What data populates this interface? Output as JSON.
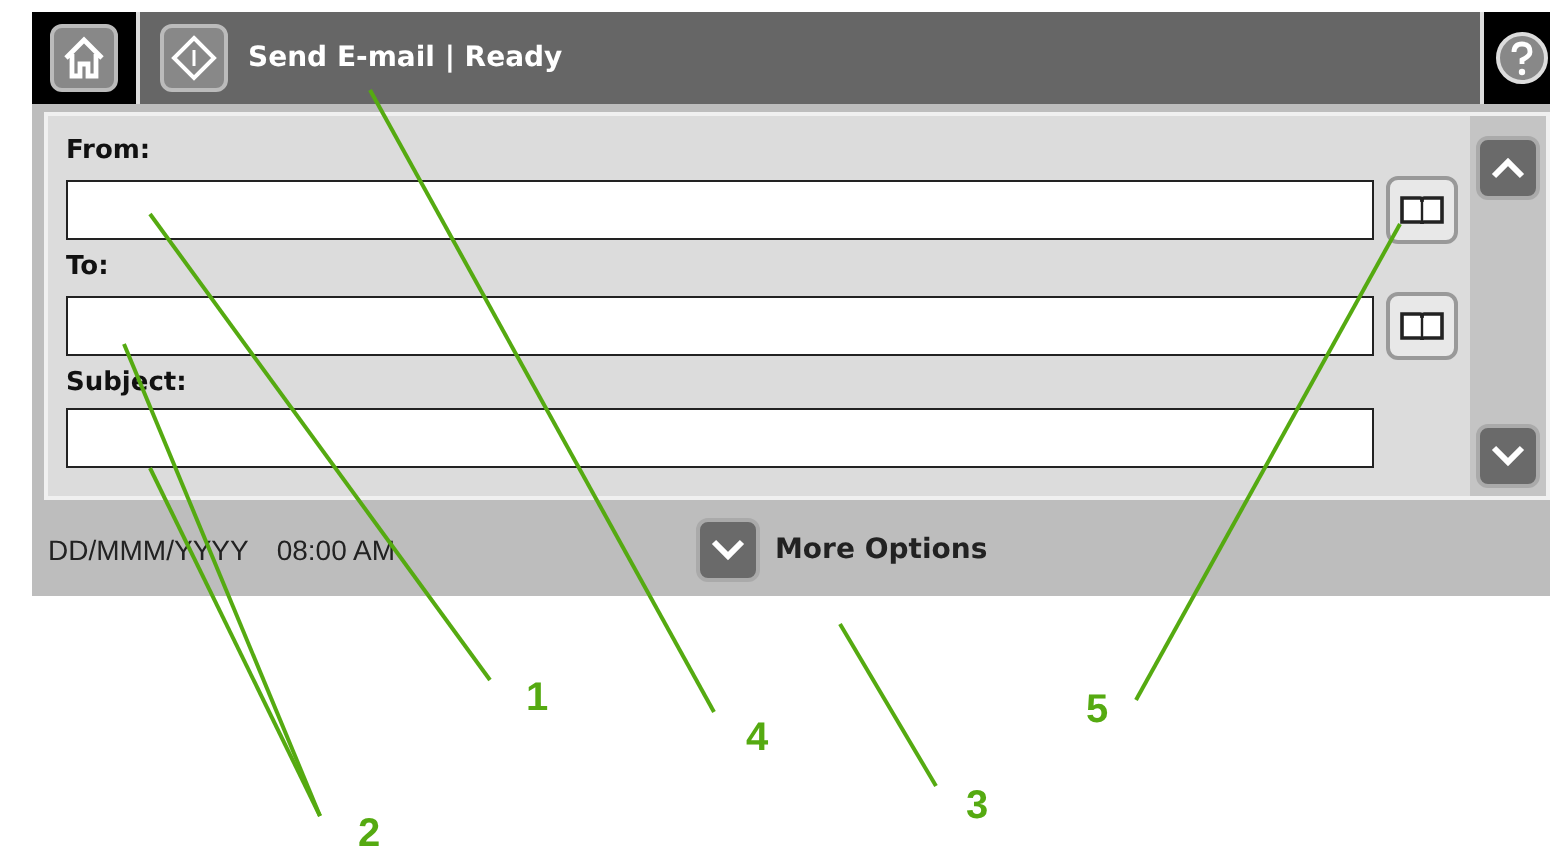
{
  "title_bar": {
    "title": "Send E-mail | Ready"
  },
  "fields": [
    {
      "label": "From:",
      "address_book": true
    },
    {
      "label": "To:",
      "address_book": true
    },
    {
      "label": "Subject:",
      "address_book": false
    }
  ],
  "status_bar": {
    "date": "DD/MMM/YYYY",
    "time": "08:00 AM",
    "more_options": "More Options"
  },
  "callouts": [
    {
      "label": "1"
    },
    {
      "label": "2"
    },
    {
      "label": "3"
    },
    {
      "label": "4"
    },
    {
      "label": "5"
    }
  ]
}
